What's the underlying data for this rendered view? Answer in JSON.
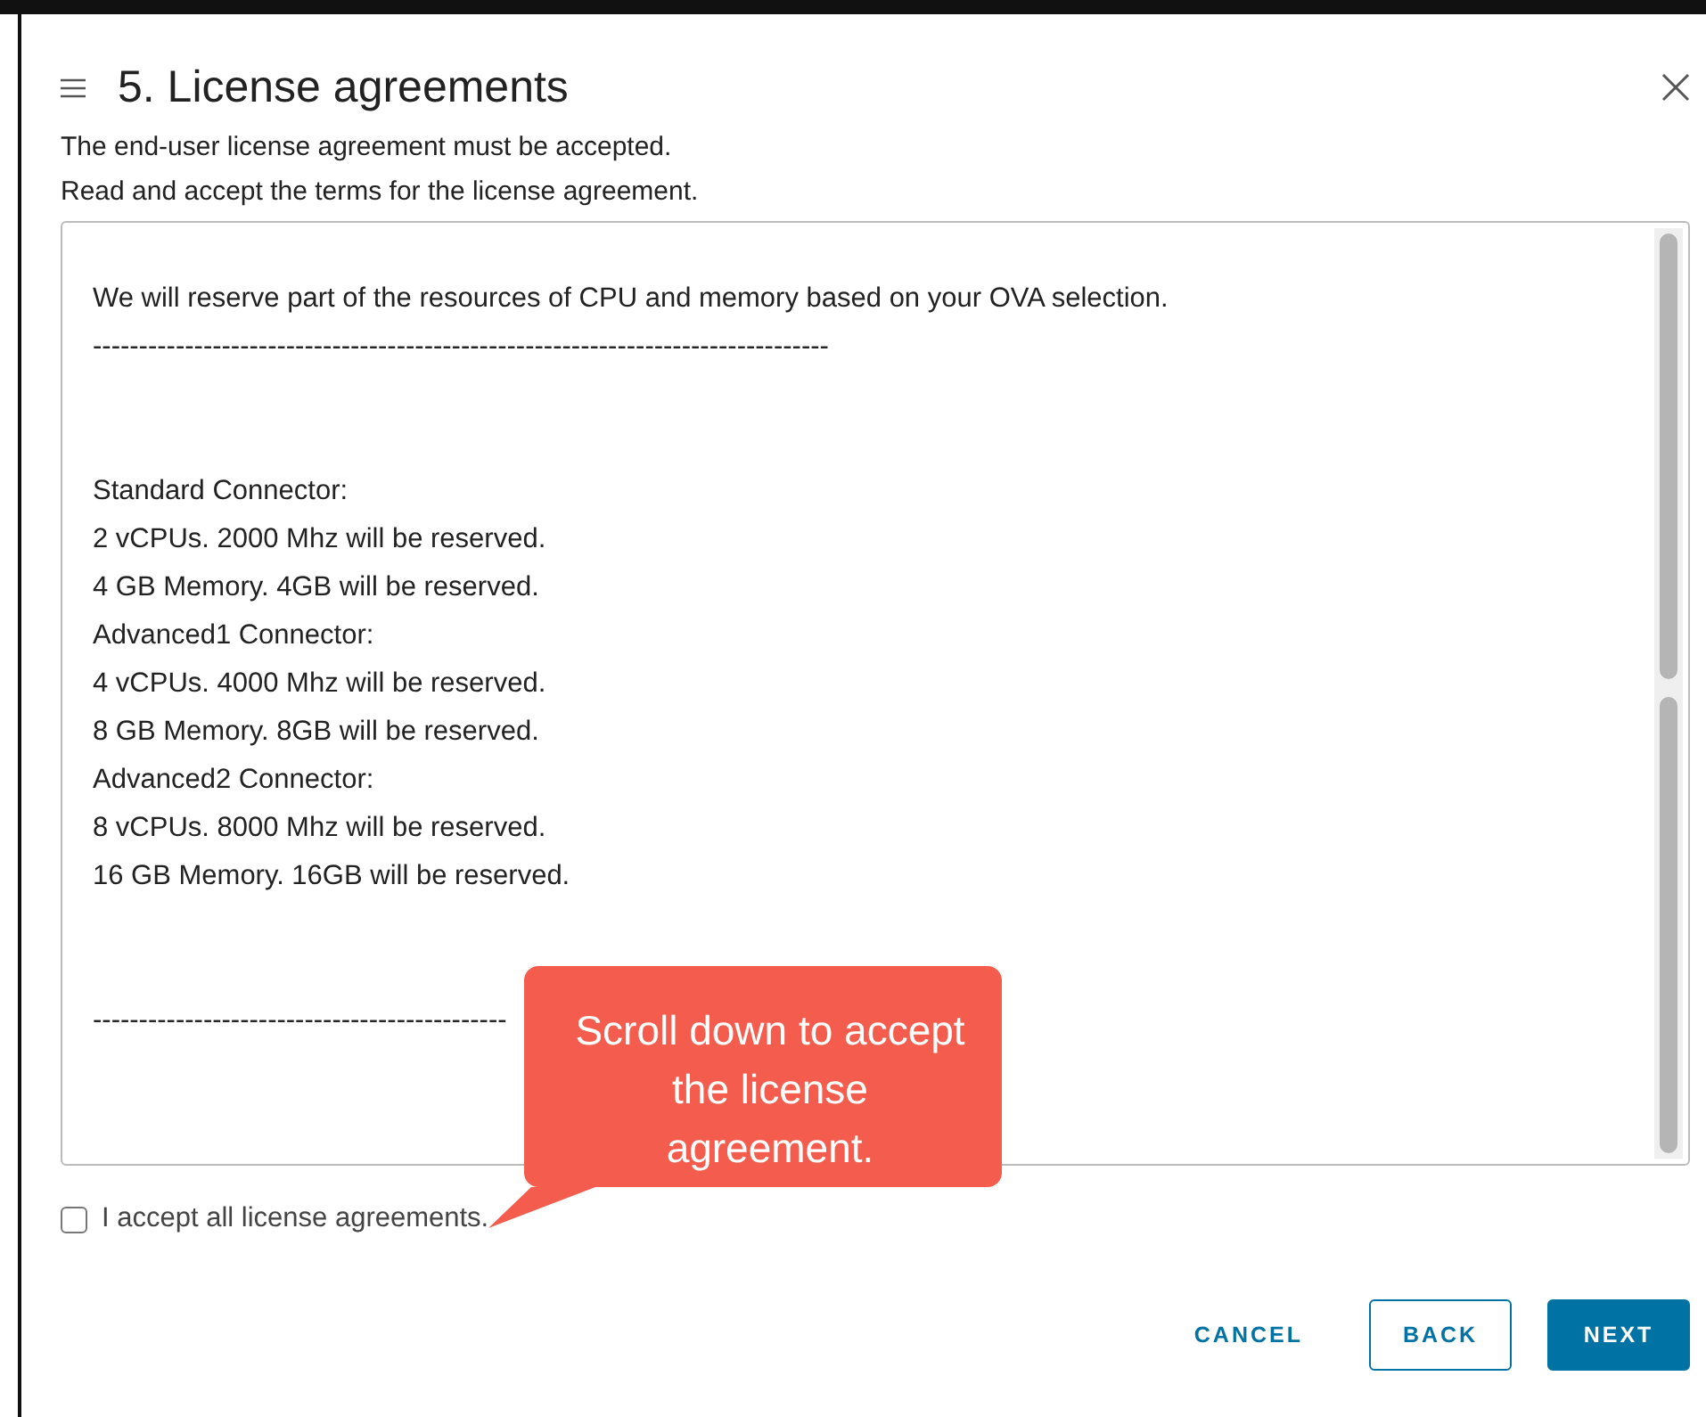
{
  "dialog": {
    "step_title": "5. License agreements",
    "notice": "The end-user license agreement must be accepted.",
    "instruction": "Read and accept the terms for the license agreement.",
    "license_blocks": [
      {
        "lines": [
          "We will reserve part of the resources of CPU and memory based on your OVA selection.",
          "--------------------------------------------------------------------------------"
        ]
      },
      {
        "lines": [
          "Standard Connector:",
          "2 vCPUs. 2000 Mhz will be reserved.",
          "4 GB Memory. 4GB will be reserved.",
          "Advanced1 Connector:",
          "4 vCPUs. 4000 Mhz will be reserved.",
          "8 GB Memory. 8GB will be reserved.",
          "Advanced2 Connector:",
          "8 vCPUs. 8000 Mhz will be reserved.",
          "16 GB Memory. 16GB will be reserved."
        ]
      },
      {
        "lines": [
          "---------------------------------------------"
        ]
      }
    ],
    "accept": {
      "label": "I accept all license agreements.",
      "checked": false
    },
    "buttons": [
      {
        "label": "CANCEL",
        "kind": "flat"
      },
      {
        "label": "BACK",
        "kind": "outline"
      },
      {
        "label": "NEXT",
        "kind": "primary"
      }
    ]
  },
  "callout": {
    "text": "Scroll down to accept the license agreement."
  }
}
